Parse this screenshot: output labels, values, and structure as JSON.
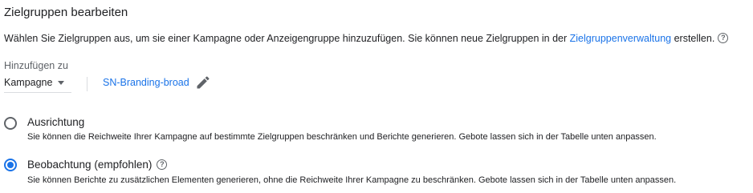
{
  "header": {
    "title": "Zielgruppen bearbeiten"
  },
  "description": {
    "text_before": "Wählen Sie Zielgruppen aus, um sie einer Kampagne oder Anzeigengruppe hinzuzufügen. Sie können neue Zielgruppen in der ",
    "link": "Zielgruppenverwaltung",
    "text_after": " erstellen.",
    "help_icon": "help-circle-icon"
  },
  "add_to": {
    "label": "Hinzufügen zu",
    "selected": "Kampagne",
    "campaign_name": "SN-Branding-broad",
    "edit_icon": "pencil-icon"
  },
  "options": [
    {
      "title": "Ausrichtung",
      "subtitle": "Sie können die Reichweite Ihrer Kampagne auf bestimmte Zielgruppen beschränken und Berichte generieren. Gebote lassen sich in der Tabelle unten anpassen.",
      "selected": false
    },
    {
      "title": "Beobachtung (empfohlen)",
      "subtitle": "Sie können Berichte zu zusätzlichen Elementen generieren, ohne die Reichweite Ihrer Kampagne zu beschränken. Gebote lassen sich in der Tabelle unten anpassen.",
      "selected": true
    }
  ],
  "colors": {
    "accent": "#1a73e8",
    "text": "#202124",
    "secondary": "#5f6368"
  }
}
